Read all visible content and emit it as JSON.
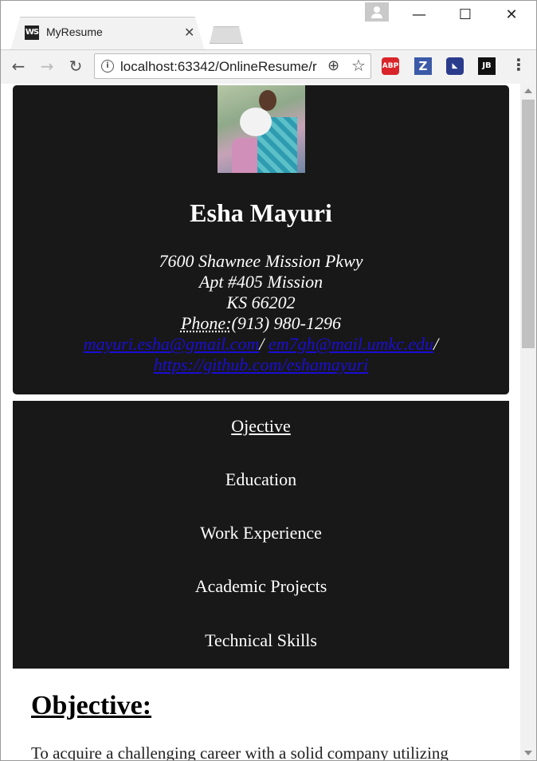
{
  "browser": {
    "tab_title": "MyResume",
    "tab_favicon_text": "WS",
    "url": "localhost:63342/OnlineResume/r",
    "extensions": {
      "adblock": "ABP",
      "z": "Z",
      "jetbrains": "JB"
    }
  },
  "header": {
    "name": "Esha Mayuri",
    "address_line1": "7600 Shawnee Mission Pkwy",
    "address_line2": "Apt #405 Mission",
    "address_line3": "KS 66202",
    "phone_label": "Phone:",
    "phone": "(913) 980-1296",
    "email1": "mayuri.esha@gmail.com",
    "email2": "em7gh@mail.umkc.edu",
    "separator": "/",
    "github": "https://github.com/eshamayuri"
  },
  "nav": {
    "items": [
      {
        "label": "Ojective"
      },
      {
        "label": "Education"
      },
      {
        "label": "Work Experience"
      },
      {
        "label": "Academic Projects"
      },
      {
        "label": "Technical Skills"
      }
    ]
  },
  "objective": {
    "title": "Objective:",
    "text": "To acquire a challenging career with a solid company utilizing"
  }
}
